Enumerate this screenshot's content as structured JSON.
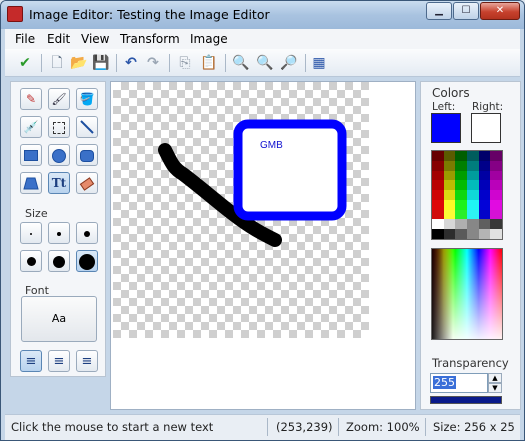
{
  "window": {
    "title": "Image Editor: Testing the Image Editor"
  },
  "menus": [
    {
      "label": "File"
    },
    {
      "label": "Edit"
    },
    {
      "label": "View"
    },
    {
      "label": "Transform"
    },
    {
      "label": "Image"
    }
  ],
  "toolbar": {
    "icons": [
      "apply-icon",
      "new-icon",
      "open-icon",
      "save-icon",
      "undo-icon",
      "redo-icon",
      "copy-icon",
      "paste-icon",
      "zoom-out-icon",
      "zoom-in-icon",
      "zoom-fit-icon",
      "grid-icon"
    ]
  },
  "tools": {
    "size_label": "Size",
    "font_label": "Font",
    "font_preview": "Aa",
    "text_tool_glyph": "Tt"
  },
  "canvas": {
    "text": "GMB",
    "stroke_color": "#000000",
    "rect_color": "#0000ff"
  },
  "colors": {
    "header": "Colors",
    "left_label": "Left:",
    "right_label": "Right:",
    "left_color": "#0000ff",
    "right_color": "#ffffff"
  },
  "transparency": {
    "label": "Transparency",
    "value": "255"
  },
  "status": {
    "message": "Click the mouse to start a new text",
    "coords": "(253,239)",
    "zoom": "Zoom: 100%",
    "size": "Size: 256 x 25"
  }
}
